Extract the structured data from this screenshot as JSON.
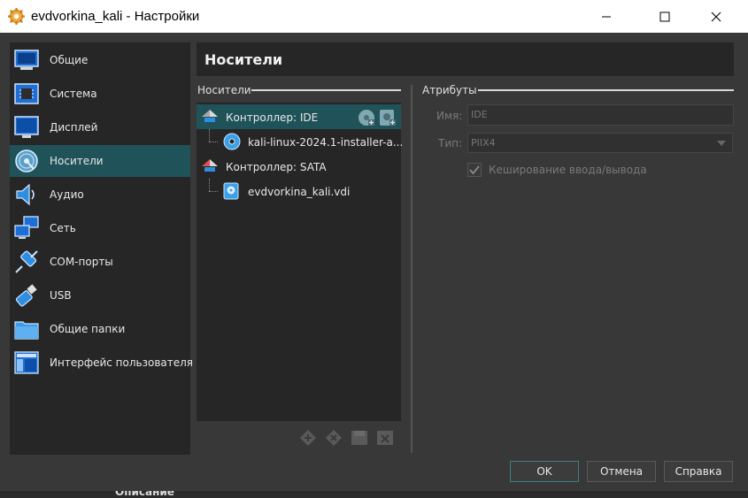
{
  "window": {
    "title": "evdvorkina_kali - Настройки",
    "icon": "gear-icon"
  },
  "sidebar": {
    "items": [
      {
        "label": "Общие",
        "icon": "general-icon"
      },
      {
        "label": "Система",
        "icon": "system-icon"
      },
      {
        "label": "Дисплей",
        "icon": "display-icon"
      },
      {
        "label": "Носители",
        "icon": "storage-icon",
        "selected": true
      },
      {
        "label": "Аудио",
        "icon": "audio-icon"
      },
      {
        "label": "Сеть",
        "icon": "network-icon"
      },
      {
        "label": "COM-порты",
        "icon": "serial-port-icon"
      },
      {
        "label": "USB",
        "icon": "usb-icon"
      },
      {
        "label": "Общие папки",
        "icon": "shared-folder-icon"
      },
      {
        "label": "Интерфейс пользователя",
        "icon": "user-interface-icon"
      }
    ]
  },
  "page": {
    "title": "Носители"
  },
  "storage": {
    "section_label": "Носители",
    "tree": [
      {
        "label": "Контроллер: IDE",
        "type": "controller",
        "selected": true
      },
      {
        "label": "kali-linux-2024.1-installer-a...",
        "type": "optical"
      },
      {
        "label": "Контроллер: SATA",
        "type": "controller"
      },
      {
        "label": "evdvorkina_kali.vdi",
        "type": "disk"
      }
    ],
    "toolbar": [
      "add-controller-icon",
      "remove-controller-icon",
      "add-attachment-icon",
      "remove-attachment-icon"
    ]
  },
  "attributes": {
    "section_label": "Атрибуты",
    "name_label": "Имя:",
    "name_value": "IDE",
    "type_label": "Тип:",
    "type_value": "PIIX4",
    "cache_label": "Кеширование ввода/вывода",
    "cache_checked": true
  },
  "buttons": {
    "ok": "OK",
    "cancel": "Отмена",
    "help": "Справка"
  },
  "background_text": "Описание",
  "colors": {
    "selection": "#1f5359",
    "panel": "#262626",
    "background": "#383838"
  }
}
